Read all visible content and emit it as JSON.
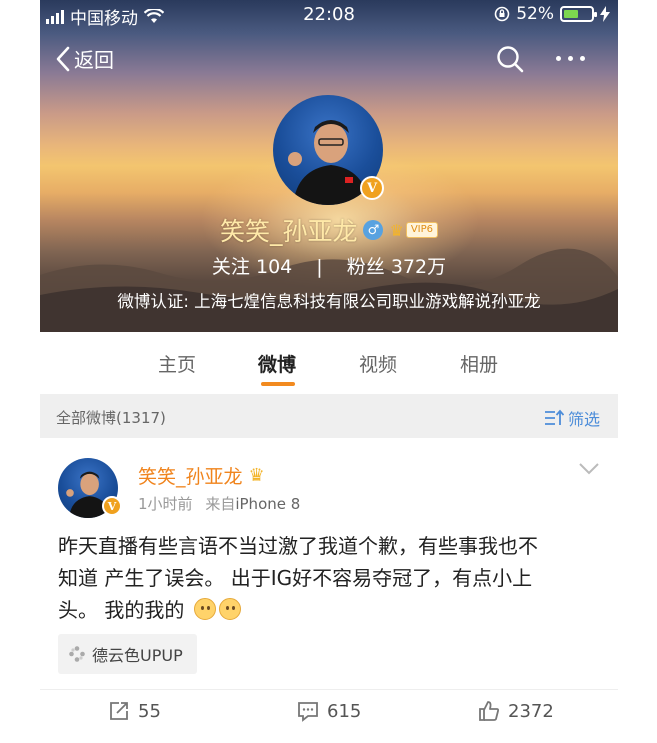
{
  "status_bar": {
    "carrier": "中国移动",
    "time": "22:08",
    "battery_percent": "52%",
    "battery_level": 0.52
  },
  "nav": {
    "back_label": "返回"
  },
  "profile": {
    "name": "笑笑_孙亚龙",
    "vip_label": "VIP6",
    "following_label": "关注",
    "following_count": "104",
    "followers_label": "粉丝",
    "followers_count": "372万",
    "verification": "微博认证: 上海七煌信息科技有限公司职业游戏解说孙亚龙",
    "badge_letter": "V"
  },
  "tabs": [
    {
      "label": "主页",
      "active": false
    },
    {
      "label": "微博",
      "active": true
    },
    {
      "label": "视频",
      "active": false
    },
    {
      "label": "相册",
      "active": false
    }
  ],
  "filter": {
    "count_label": "全部微博(1317)",
    "filter_button": "筛选"
  },
  "post": {
    "author": "笑笑_孙亚龙",
    "time": "1小时前",
    "source_prefix": "来自",
    "source": "iPhone 8",
    "text_lines": [
      "昨天直播有些言语不当过激了我道个歉，有些事我也不",
      "知道 产生了误会。 出于IG好不容易夺冠了，有点小上",
      "头。 我的我的"
    ],
    "location": "德云色UPUP",
    "reposts": "55",
    "comments": "615",
    "likes": "2372"
  },
  "colors": {
    "accent_orange": "#f28a1f",
    "link_blue": "#4d8dd9",
    "name_orange": "#f0841d"
  }
}
